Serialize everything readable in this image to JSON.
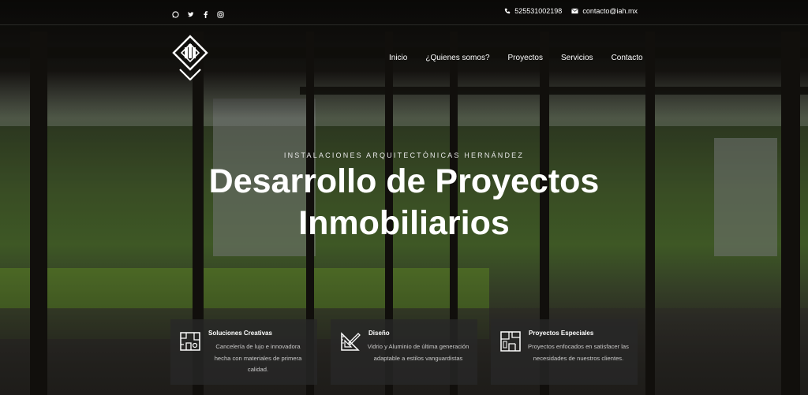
{
  "topbar": {
    "social": [
      "whatsapp-icon",
      "twitter-icon",
      "facebook-icon",
      "instagram-icon"
    ],
    "phone": "525531002198",
    "email": "contacto@iah.mx"
  },
  "nav": {
    "items": [
      "Inicio",
      "¿Quienes somos?",
      "Proyectos",
      "Servicios",
      "Contacto"
    ]
  },
  "hero": {
    "eyebrow": "INSTALACIONES ARQUITECTÓNICAS HERNÁNDEZ",
    "title_line1": "Desarrollo de Proyectos",
    "title_line2": "Inmobiliarios"
  },
  "cards": [
    {
      "title": "Soluciones Creativas",
      "text": "Cancelería de lujo e innovadora hecha con materiales de primera calidad.",
      "icon": "blueprint-icon"
    },
    {
      "title": "Diseño",
      "text": "Vidrio y Aluminio de última generación adaptable a estilos vanguardistas",
      "icon": "drafting-tools-icon"
    },
    {
      "title": "Proyectos Especiales",
      "text": "Proyectos enfocados en satisfacer las necesidades de nuestros clientes.",
      "icon": "floor-plan-icon"
    }
  ],
  "colors": {
    "text": "#ffffff",
    "card_bg": "#282828"
  }
}
